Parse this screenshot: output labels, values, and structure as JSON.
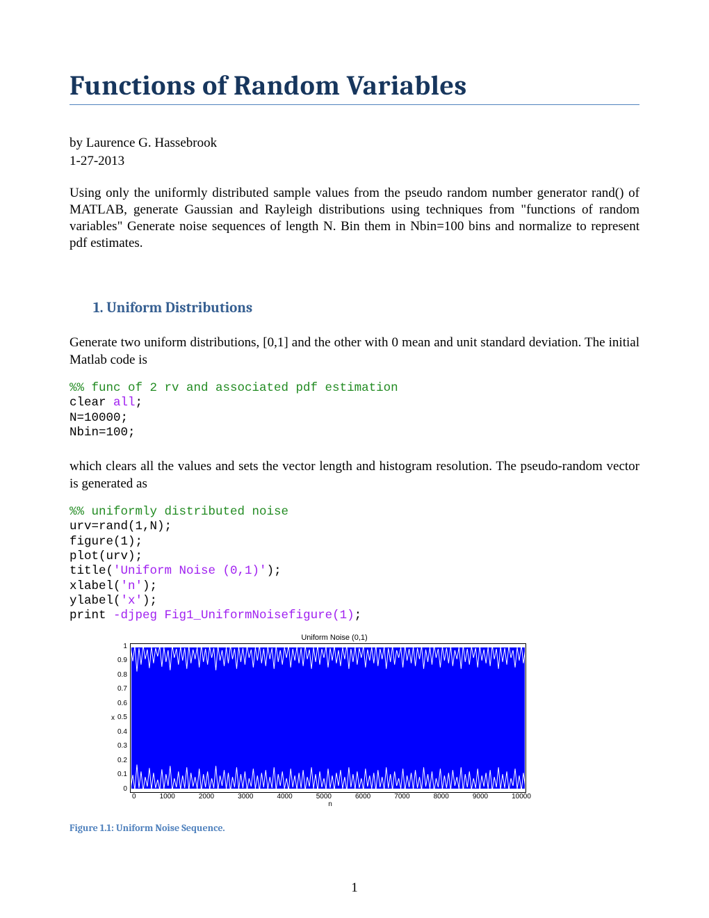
{
  "title": "Functions of Random Variables",
  "author": "by Laurence G. Hassebrook",
  "date": "1-27-2013",
  "intro": "Using only the uniformly distributed sample values from the pseudo random number generator rand() of MATLAB, generate Gaussian and Rayleigh distributions using techniques from \"functions of random variables\" Generate noise sequences of length N. Bin them in Nbin=100 bins and normalize to represent pdf estimates.",
  "section1": {
    "heading": "1.  Uniform Distributions",
    "p1": "Generate two uniform distributions, [0,1] and the other with 0 mean and unit standard deviation. The initial Matlab code is",
    "code1": {
      "comment": "%% func of 2 rv and associated pdf estimation",
      "line2a": "clear ",
      "line2b": "all",
      "line2c": ";",
      "line3": "N=10000;",
      "line4": "Nbin=100;"
    },
    "p2": "which clears all the values and sets the vector length and histogram resolution. The pseudo-random vector is generated as",
    "code2": {
      "comment": "%% uniformly distributed noise",
      "line2": "urv=rand(1,N);",
      "line3": "figure(1);",
      "line4": "plot(urv);",
      "line5a": "title(",
      "line5b": "'Uniform Noise (0,1)'",
      "line5c": ");",
      "line6a": "xlabel(",
      "line6b": "'n'",
      "line6c": ");",
      "line7a": "ylabel(",
      "line7b": "'x'",
      "line7c": ");",
      "line8a": "print ",
      "line8b": "-djpeg ",
      "line8c": "Fig1_UniformNoisefigure(1)",
      "line8d": ";"
    }
  },
  "chart_data": {
    "type": "line",
    "title": "Uniform Noise (0,1)",
    "xlabel": "n",
    "ylabel": "x",
    "xlim": [
      0,
      10000
    ],
    "ylim": [
      0,
      1
    ],
    "xticks": [
      "0",
      "1000",
      "2000",
      "3000",
      "4000",
      "5000",
      "6000",
      "7000",
      "8000",
      "9000",
      "10000"
    ],
    "yticks": [
      "1",
      "0.9",
      "0.8",
      "0.7",
      "0.6",
      "0.5",
      "0.4",
      "0.3",
      "0.2",
      "0.1",
      "0"
    ],
    "description": "Dense uniform noise sequence filling the range 0 to 1 across 10000 samples, plotted in blue."
  },
  "figure_caption": "Figure 1.1: Uniform Noise Sequence.",
  "page_number": "1"
}
